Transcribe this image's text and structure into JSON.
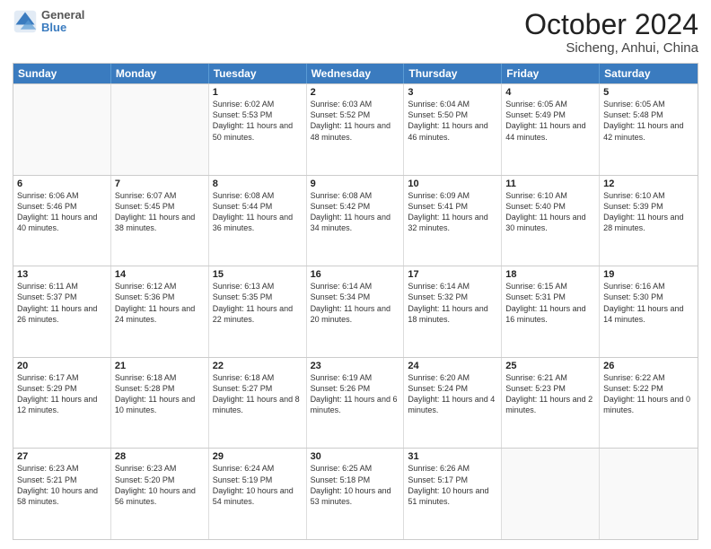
{
  "header": {
    "logo_line1": "General",
    "logo_line2": "Blue",
    "title": "October 2024",
    "subtitle": "Sicheng, Anhui, China"
  },
  "days": [
    "Sunday",
    "Monday",
    "Tuesday",
    "Wednesday",
    "Thursday",
    "Friday",
    "Saturday"
  ],
  "weeks": [
    [
      {
        "day": "",
        "sunrise": "",
        "sunset": "",
        "daylight": ""
      },
      {
        "day": "",
        "sunrise": "",
        "sunset": "",
        "daylight": ""
      },
      {
        "day": "1",
        "sunrise": "Sunrise: 6:02 AM",
        "sunset": "Sunset: 5:53 PM",
        "daylight": "Daylight: 11 hours and 50 minutes."
      },
      {
        "day": "2",
        "sunrise": "Sunrise: 6:03 AM",
        "sunset": "Sunset: 5:52 PM",
        "daylight": "Daylight: 11 hours and 48 minutes."
      },
      {
        "day": "3",
        "sunrise": "Sunrise: 6:04 AM",
        "sunset": "Sunset: 5:50 PM",
        "daylight": "Daylight: 11 hours and 46 minutes."
      },
      {
        "day": "4",
        "sunrise": "Sunrise: 6:05 AM",
        "sunset": "Sunset: 5:49 PM",
        "daylight": "Daylight: 11 hours and 44 minutes."
      },
      {
        "day": "5",
        "sunrise": "Sunrise: 6:05 AM",
        "sunset": "Sunset: 5:48 PM",
        "daylight": "Daylight: 11 hours and 42 minutes."
      }
    ],
    [
      {
        "day": "6",
        "sunrise": "Sunrise: 6:06 AM",
        "sunset": "Sunset: 5:46 PM",
        "daylight": "Daylight: 11 hours and 40 minutes."
      },
      {
        "day": "7",
        "sunrise": "Sunrise: 6:07 AM",
        "sunset": "Sunset: 5:45 PM",
        "daylight": "Daylight: 11 hours and 38 minutes."
      },
      {
        "day": "8",
        "sunrise": "Sunrise: 6:08 AM",
        "sunset": "Sunset: 5:44 PM",
        "daylight": "Daylight: 11 hours and 36 minutes."
      },
      {
        "day": "9",
        "sunrise": "Sunrise: 6:08 AM",
        "sunset": "Sunset: 5:42 PM",
        "daylight": "Daylight: 11 hours and 34 minutes."
      },
      {
        "day": "10",
        "sunrise": "Sunrise: 6:09 AM",
        "sunset": "Sunset: 5:41 PM",
        "daylight": "Daylight: 11 hours and 32 minutes."
      },
      {
        "day": "11",
        "sunrise": "Sunrise: 6:10 AM",
        "sunset": "Sunset: 5:40 PM",
        "daylight": "Daylight: 11 hours and 30 minutes."
      },
      {
        "day": "12",
        "sunrise": "Sunrise: 6:10 AM",
        "sunset": "Sunset: 5:39 PM",
        "daylight": "Daylight: 11 hours and 28 minutes."
      }
    ],
    [
      {
        "day": "13",
        "sunrise": "Sunrise: 6:11 AM",
        "sunset": "Sunset: 5:37 PM",
        "daylight": "Daylight: 11 hours and 26 minutes."
      },
      {
        "day": "14",
        "sunrise": "Sunrise: 6:12 AM",
        "sunset": "Sunset: 5:36 PM",
        "daylight": "Daylight: 11 hours and 24 minutes."
      },
      {
        "day": "15",
        "sunrise": "Sunrise: 6:13 AM",
        "sunset": "Sunset: 5:35 PM",
        "daylight": "Daylight: 11 hours and 22 minutes."
      },
      {
        "day": "16",
        "sunrise": "Sunrise: 6:14 AM",
        "sunset": "Sunset: 5:34 PM",
        "daylight": "Daylight: 11 hours and 20 minutes."
      },
      {
        "day": "17",
        "sunrise": "Sunrise: 6:14 AM",
        "sunset": "Sunset: 5:32 PM",
        "daylight": "Daylight: 11 hours and 18 minutes."
      },
      {
        "day": "18",
        "sunrise": "Sunrise: 6:15 AM",
        "sunset": "Sunset: 5:31 PM",
        "daylight": "Daylight: 11 hours and 16 minutes."
      },
      {
        "day": "19",
        "sunrise": "Sunrise: 6:16 AM",
        "sunset": "Sunset: 5:30 PM",
        "daylight": "Daylight: 11 hours and 14 minutes."
      }
    ],
    [
      {
        "day": "20",
        "sunrise": "Sunrise: 6:17 AM",
        "sunset": "Sunset: 5:29 PM",
        "daylight": "Daylight: 11 hours and 12 minutes."
      },
      {
        "day": "21",
        "sunrise": "Sunrise: 6:18 AM",
        "sunset": "Sunset: 5:28 PM",
        "daylight": "Daylight: 11 hours and 10 minutes."
      },
      {
        "day": "22",
        "sunrise": "Sunrise: 6:18 AM",
        "sunset": "Sunset: 5:27 PM",
        "daylight": "Daylight: 11 hours and 8 minutes."
      },
      {
        "day": "23",
        "sunrise": "Sunrise: 6:19 AM",
        "sunset": "Sunset: 5:26 PM",
        "daylight": "Daylight: 11 hours and 6 minutes."
      },
      {
        "day": "24",
        "sunrise": "Sunrise: 6:20 AM",
        "sunset": "Sunset: 5:24 PM",
        "daylight": "Daylight: 11 hours and 4 minutes."
      },
      {
        "day": "25",
        "sunrise": "Sunrise: 6:21 AM",
        "sunset": "Sunset: 5:23 PM",
        "daylight": "Daylight: 11 hours and 2 minutes."
      },
      {
        "day": "26",
        "sunrise": "Sunrise: 6:22 AM",
        "sunset": "Sunset: 5:22 PM",
        "daylight": "Daylight: 11 hours and 0 minutes."
      }
    ],
    [
      {
        "day": "27",
        "sunrise": "Sunrise: 6:23 AM",
        "sunset": "Sunset: 5:21 PM",
        "daylight": "Daylight: 10 hours and 58 minutes."
      },
      {
        "day": "28",
        "sunrise": "Sunrise: 6:23 AM",
        "sunset": "Sunset: 5:20 PM",
        "daylight": "Daylight: 10 hours and 56 minutes."
      },
      {
        "day": "29",
        "sunrise": "Sunrise: 6:24 AM",
        "sunset": "Sunset: 5:19 PM",
        "daylight": "Daylight: 10 hours and 54 minutes."
      },
      {
        "day": "30",
        "sunrise": "Sunrise: 6:25 AM",
        "sunset": "Sunset: 5:18 PM",
        "daylight": "Daylight: 10 hours and 53 minutes."
      },
      {
        "day": "31",
        "sunrise": "Sunrise: 6:26 AM",
        "sunset": "Sunset: 5:17 PM",
        "daylight": "Daylight: 10 hours and 51 minutes."
      },
      {
        "day": "",
        "sunrise": "",
        "sunset": "",
        "daylight": ""
      },
      {
        "day": "",
        "sunrise": "",
        "sunset": "",
        "daylight": ""
      }
    ]
  ]
}
